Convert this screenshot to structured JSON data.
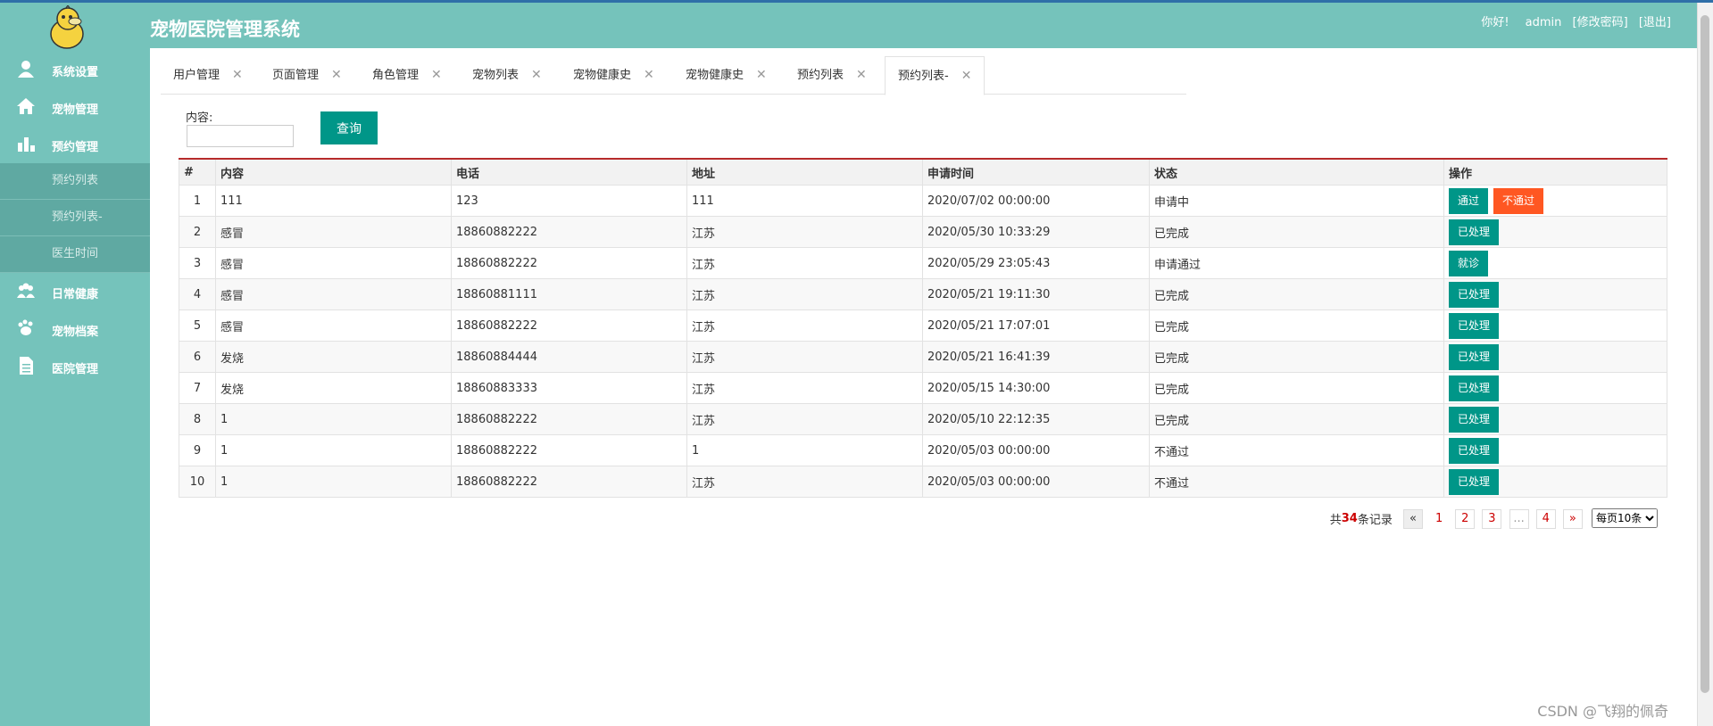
{
  "header": {
    "title": "宠物医院管理系统",
    "greeting": "你好!",
    "username": "admin",
    "change_password": "[修改密码]",
    "logout": "[退出]"
  },
  "sidebar": {
    "items": [
      {
        "label": "系统设置",
        "icon": "user-icon"
      },
      {
        "label": "宠物管理",
        "icon": "home-icon"
      },
      {
        "label": "预约管理",
        "icon": "chart-icon"
      },
      {
        "label": "日常健康",
        "icon": "group-icon"
      },
      {
        "label": "宠物档案",
        "icon": "pet-icon"
      },
      {
        "label": "医院管理",
        "icon": "document-icon"
      }
    ],
    "subitems": [
      "预约列表",
      "预约列表-",
      "医生时间"
    ]
  },
  "tabs": [
    {
      "label": "用户管理"
    },
    {
      "label": "页面管理"
    },
    {
      "label": "角色管理"
    },
    {
      "label": "宠物列表"
    },
    {
      "label": "宠物健康史"
    },
    {
      "label": "宠物健康史"
    },
    {
      "label": "预约列表"
    },
    {
      "label": "预约列表-",
      "active": true
    }
  ],
  "search": {
    "label": "内容:",
    "value": "",
    "button": "查询"
  },
  "table": {
    "headers": [
      "#",
      "内容",
      "电话",
      "地址",
      "申请时间",
      "状态",
      "操作"
    ],
    "rows": [
      {
        "no": "1",
        "content": "111",
        "phone": "123",
        "address": "111",
        "time": "2020/07/02 00:00:00",
        "status": "申请中",
        "actions": [
          "通过",
          "不通过"
        ]
      },
      {
        "no": "2",
        "content": "感冒",
        "phone": "18860882222",
        "address": "江苏",
        "time": "2020/05/30 10:33:29",
        "status": "已完成",
        "actions": [
          "已处理"
        ]
      },
      {
        "no": "3",
        "content": "感冒",
        "phone": "18860882222",
        "address": "江苏",
        "time": "2020/05/29 23:05:43",
        "status": "申请通过",
        "actions": [
          "就诊"
        ]
      },
      {
        "no": "4",
        "content": "感冒",
        "phone": "18860881111",
        "address": "江苏",
        "time": "2020/05/21 19:11:30",
        "status": "已完成",
        "actions": [
          "已处理"
        ]
      },
      {
        "no": "5",
        "content": "感冒",
        "phone": "18860882222",
        "address": "江苏",
        "time": "2020/05/21 17:07:01",
        "status": "已完成",
        "actions": [
          "已处理"
        ]
      },
      {
        "no": "6",
        "content": "发烧",
        "phone": "18860884444",
        "address": "江苏",
        "time": "2020/05/21 16:41:39",
        "status": "已完成",
        "actions": [
          "已处理"
        ]
      },
      {
        "no": "7",
        "content": "发烧",
        "phone": "18860883333",
        "address": "江苏",
        "time": "2020/05/15 14:30:00",
        "status": "已完成",
        "actions": [
          "已处理"
        ]
      },
      {
        "no": "8",
        "content": "1",
        "phone": "18860882222",
        "address": "江苏",
        "time": "2020/05/10 22:12:35",
        "status": "已完成",
        "actions": [
          "已处理"
        ]
      },
      {
        "no": "9",
        "content": "1",
        "phone": "18860882222",
        "address": "1",
        "time": "2020/05/03 00:00:00",
        "status": "不通过",
        "actions": [
          "已处理"
        ]
      },
      {
        "no": "10",
        "content": "1",
        "phone": "18860882222",
        "address": "江苏",
        "time": "2020/05/03 00:00:00",
        "status": "不通过",
        "actions": [
          "已处理"
        ]
      }
    ]
  },
  "pagination": {
    "total_prefix": "共",
    "total": "34",
    "total_suffix": "条记录",
    "prev": "«",
    "pages": [
      "1",
      "2",
      "3",
      "...",
      "4"
    ],
    "current": "1",
    "next": "»",
    "page_size": "每页10条"
  },
  "watermark": "CSDN @飞翔的佩奇",
  "colors": {
    "sidebar": "#75c3bb",
    "primary_button": "#009688",
    "danger_button": "#ff5722",
    "table_top_border": "#b72b2b"
  }
}
